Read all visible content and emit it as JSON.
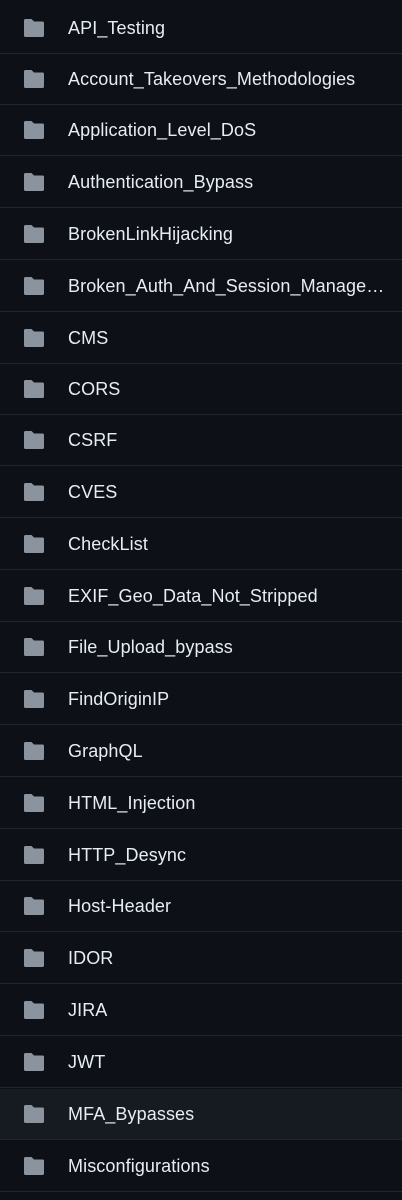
{
  "icon": {
    "name": "folder-icon",
    "color": "#8b949e"
  },
  "hover_color": "#161b22",
  "folders": [
    {
      "name": "API_Testing"
    },
    {
      "name": "Account_Takeovers_Methodologies"
    },
    {
      "name": "Application_Level_DoS"
    },
    {
      "name": "Authentication_Bypass"
    },
    {
      "name": "BrokenLinkHijacking"
    },
    {
      "name": "Broken_Auth_And_Session_Management"
    },
    {
      "name": "CMS"
    },
    {
      "name": "CORS"
    },
    {
      "name": "CSRF"
    },
    {
      "name": "CVES"
    },
    {
      "name": "CheckList"
    },
    {
      "name": "EXIF_Geo_Data_Not_Stripped"
    },
    {
      "name": "File_Upload_bypass"
    },
    {
      "name": "FindOriginIP"
    },
    {
      "name": "GraphQL"
    },
    {
      "name": "HTML_Injection"
    },
    {
      "name": "HTTP_Desync"
    },
    {
      "name": "Host-Header"
    },
    {
      "name": "IDOR"
    },
    {
      "name": "JIRA"
    },
    {
      "name": "JWT"
    },
    {
      "name": "MFA_Bypasses",
      "hovered": true
    },
    {
      "name": "Misconfigurations"
    }
  ]
}
